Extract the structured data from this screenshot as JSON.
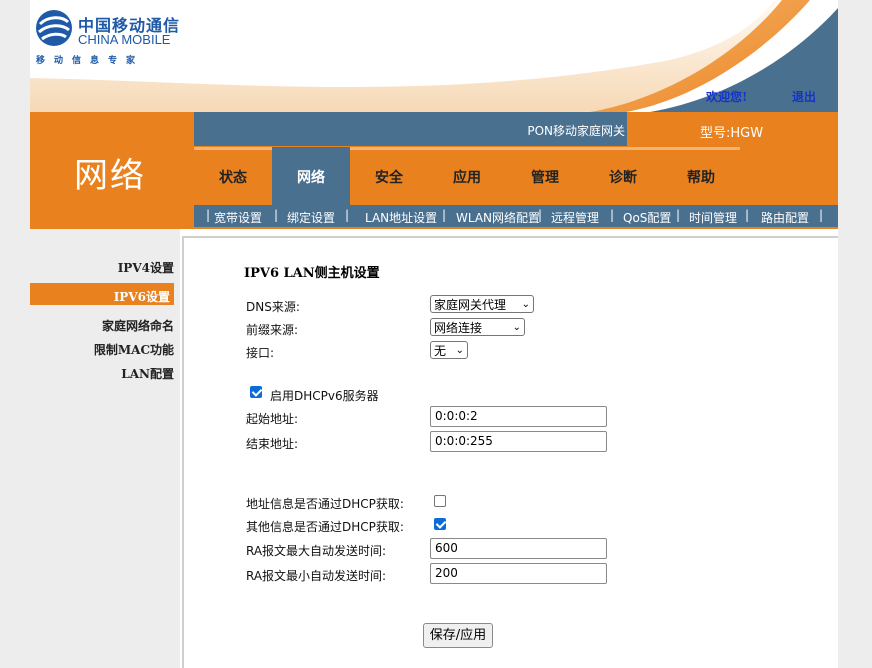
{
  "brand": {
    "name_cn": "中国移动通信",
    "name_en": "CHINA MOBILE",
    "slogan": "移动信息专家"
  },
  "header": {
    "welcome": "欢迎您!",
    "logout": "退出",
    "device_name": "PON移动家庭网关",
    "model": "型号:HGW"
  },
  "section_title": "网络",
  "tabs": [
    "状态",
    "网络",
    "安全",
    "应用",
    "管理",
    "诊断",
    "帮助"
  ],
  "active_tab": "网络",
  "subnav": [
    "宽带设置",
    "绑定设置",
    "LAN地址设置",
    "WLAN网络配置",
    "远程管理",
    "QoS配置",
    "时间管理",
    "路由配置"
  ],
  "sidebar": [
    "IPV4设置",
    "IPV6设置",
    "家庭网络命名",
    "限制MAC功能",
    "LAN配置"
  ],
  "active_sidebar": "IPV6设置",
  "form": {
    "title": "IPV6 LAN侧主机设置",
    "dns_source_label": "DNS来源:",
    "dns_source_value": "家庭网关代理",
    "prefix_source_label": "前缀来源:",
    "prefix_source_value": "网络连接",
    "interface_label": "接口:",
    "interface_value": "无",
    "dhcpv6_label": "启用DHCPv6服务器",
    "dhcpv6_checked": true,
    "start_addr_label": "起始地址:",
    "start_addr_value": "0:0:0:2",
    "end_addr_label": "结束地址:",
    "end_addr_value": "0:0:0:255",
    "addr_dhcp_label": "地址信息是否通过DHCP获取:",
    "addr_dhcp_checked": false,
    "other_dhcp_label": "其他信息是否通过DHCP获取:",
    "other_dhcp_checked": true,
    "ra_max_label": "RA报文最大自动发送时间:",
    "ra_max_value": "600",
    "ra_min_label": "RA报文最小自动发送时间:",
    "ra_min_value": "200",
    "save_label": "保存/应用"
  },
  "colors": {
    "brand_orange": "#e9821e",
    "nav_blue": "#4a7090",
    "logo_blue": "#1e5aa8",
    "checkbox_blue": "#0b6cd7"
  }
}
